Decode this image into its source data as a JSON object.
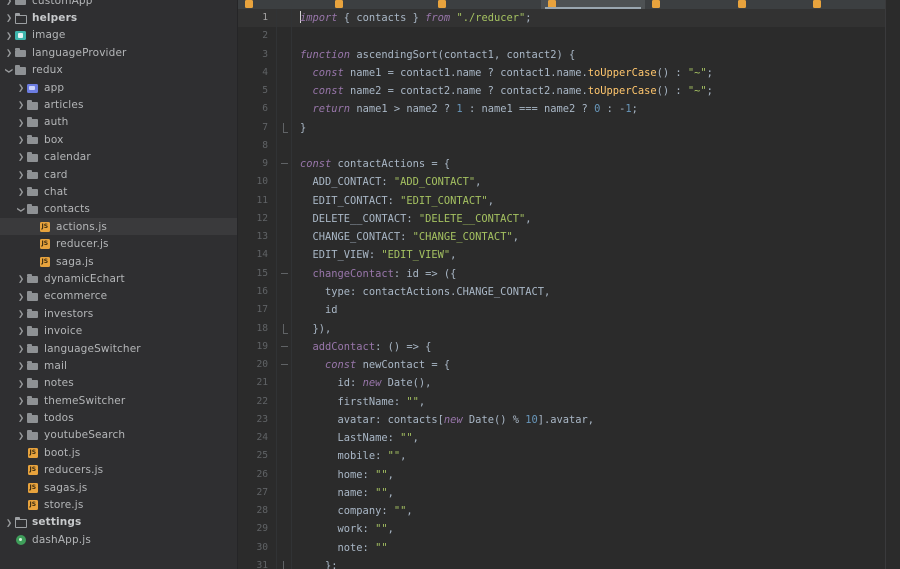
{
  "app": {
    "theme_bg": "#2b2b2b",
    "sidebar_bg": "#2f2f31",
    "accent": "#e8a33d"
  },
  "sidebar": {
    "name": "project-tree",
    "items": [
      {
        "label": "customApp",
        "indent": 1,
        "icon": "folder",
        "arrow": "closed",
        "bold": false,
        "selected": false
      },
      {
        "label": "helpers",
        "indent": 1,
        "icon": "folder-open",
        "arrow": "closed",
        "bold": true,
        "selected": false
      },
      {
        "label": "image",
        "indent": 1,
        "icon": "img-folder",
        "arrow": "closed",
        "bold": false,
        "selected": false
      },
      {
        "label": "languageProvider",
        "indent": 1,
        "icon": "folder",
        "arrow": "closed",
        "bold": false,
        "selected": false
      },
      {
        "label": "redux",
        "indent": 1,
        "icon": "folder",
        "arrow": "open",
        "bold": false,
        "selected": false
      },
      {
        "label": "app",
        "indent": 2,
        "icon": "blue-folder",
        "arrow": "closed",
        "bold": false,
        "selected": false
      },
      {
        "label": "articles",
        "indent": 2,
        "icon": "folder",
        "arrow": "closed",
        "bold": false,
        "selected": false
      },
      {
        "label": "auth",
        "indent": 2,
        "icon": "folder",
        "arrow": "closed",
        "bold": false,
        "selected": false
      },
      {
        "label": "box",
        "indent": 2,
        "icon": "folder",
        "arrow": "closed",
        "bold": false,
        "selected": false
      },
      {
        "label": "calendar",
        "indent": 2,
        "icon": "folder",
        "arrow": "closed",
        "bold": false,
        "selected": false
      },
      {
        "label": "card",
        "indent": 2,
        "icon": "folder",
        "arrow": "closed",
        "bold": false,
        "selected": false
      },
      {
        "label": "chat",
        "indent": 2,
        "icon": "folder",
        "arrow": "closed",
        "bold": false,
        "selected": false
      },
      {
        "label": "contacts",
        "indent": 2,
        "icon": "folder",
        "arrow": "open",
        "bold": false,
        "selected": false
      },
      {
        "label": "actions.js",
        "indent": 3,
        "icon": "js",
        "arrow": "none",
        "bold": false,
        "selected": true
      },
      {
        "label": "reducer.js",
        "indent": 3,
        "icon": "js",
        "arrow": "none",
        "bold": false,
        "selected": false
      },
      {
        "label": "saga.js",
        "indent": 3,
        "icon": "js",
        "arrow": "none",
        "bold": false,
        "selected": false
      },
      {
        "label": "dynamicEchart",
        "indent": 2,
        "icon": "folder",
        "arrow": "closed",
        "bold": false,
        "selected": false
      },
      {
        "label": "ecommerce",
        "indent": 2,
        "icon": "folder",
        "arrow": "closed",
        "bold": false,
        "selected": false
      },
      {
        "label": "investors",
        "indent": 2,
        "icon": "folder",
        "arrow": "closed",
        "bold": false,
        "selected": false
      },
      {
        "label": "invoice",
        "indent": 2,
        "icon": "folder",
        "arrow": "closed",
        "bold": false,
        "selected": false
      },
      {
        "label": "languageSwitcher",
        "indent": 2,
        "icon": "folder",
        "arrow": "closed",
        "bold": false,
        "selected": false
      },
      {
        "label": "mail",
        "indent": 2,
        "icon": "folder",
        "arrow": "closed",
        "bold": false,
        "selected": false
      },
      {
        "label": "notes",
        "indent": 2,
        "icon": "folder",
        "arrow": "closed",
        "bold": false,
        "selected": false
      },
      {
        "label": "themeSwitcher",
        "indent": 2,
        "icon": "folder",
        "arrow": "closed",
        "bold": false,
        "selected": false
      },
      {
        "label": "todos",
        "indent": 2,
        "icon": "folder",
        "arrow": "closed",
        "bold": false,
        "selected": false
      },
      {
        "label": "youtubeSearch",
        "indent": 2,
        "icon": "folder",
        "arrow": "closed",
        "bold": false,
        "selected": false
      },
      {
        "label": "boot.js",
        "indent": 2,
        "icon": "js",
        "arrow": "none",
        "bold": false,
        "selected": false
      },
      {
        "label": "reducers.js",
        "indent": 2,
        "icon": "js",
        "arrow": "none",
        "bold": false,
        "selected": false
      },
      {
        "label": "sagas.js",
        "indent": 2,
        "icon": "js",
        "arrow": "none",
        "bold": false,
        "selected": false
      },
      {
        "label": "store.js",
        "indent": 2,
        "icon": "js",
        "arrow": "none",
        "bold": false,
        "selected": false
      },
      {
        "label": "settings",
        "indent": 1,
        "icon": "folder-open",
        "arrow": "closed",
        "bold": true,
        "selected": false
      },
      {
        "label": "dashApp.js",
        "indent": 1,
        "icon": "green-circle",
        "arrow": "none",
        "bold": false,
        "selected": false
      }
    ]
  },
  "tabs": {
    "name": "editor-tabs",
    "items": [
      {
        "label": "",
        "icon": "js-file-icon",
        "active": false
      },
      {
        "label": "",
        "icon": "js-file-icon",
        "active": false
      },
      {
        "label": "",
        "icon": "js-file-icon",
        "active": false
      },
      {
        "label": "",
        "icon": "js-file-icon",
        "active": true
      },
      {
        "label": "",
        "icon": "js-file-icon",
        "active": false
      },
      {
        "label": "",
        "icon": "js-file-icon",
        "active": false
      },
      {
        "label": "",
        "icon": "js-file-icon",
        "active": false
      }
    ]
  },
  "editor": {
    "file": "actions.js",
    "caret_line": 1,
    "caret_column": 1,
    "first_line": 1,
    "last_line": 31,
    "lines": [
      {
        "n": "1",
        "fold": "",
        "hl": true,
        "tokens": [
          {
            "t": "caret",
            "v": ""
          },
          {
            "c": "kwi",
            "v": "import"
          },
          {
            "c": "plain",
            "v": " { "
          },
          {
            "c": "plain",
            "v": "contacts"
          },
          {
            "c": "plain",
            "v": " } "
          },
          {
            "c": "kwi",
            "v": "from"
          },
          {
            "c": "plain",
            "v": " "
          },
          {
            "c": "str",
            "v": "\"./reducer\""
          },
          {
            "c": "plain",
            "v": ";"
          }
        ]
      },
      {
        "n": "2",
        "fold": "",
        "hl": false,
        "tokens": []
      },
      {
        "n": "3",
        "fold": "",
        "hl": false,
        "tokens": [
          {
            "c": "kwi",
            "v": "function"
          },
          {
            "c": "plain",
            "v": " "
          },
          {
            "c": "plain",
            "v": "ascendingSort"
          },
          {
            "c": "plain",
            "v": "(contact1, contact2) {"
          }
        ]
      },
      {
        "n": "4",
        "fold": "",
        "hl": false,
        "tokens": [
          {
            "c": "plain",
            "v": "  "
          },
          {
            "c": "kwi",
            "v": "const"
          },
          {
            "c": "plain",
            "v": " name1 = contact1.name ? contact1.name."
          },
          {
            "c": "fn",
            "v": "toUpperCase"
          },
          {
            "c": "plain",
            "v": "() : "
          },
          {
            "c": "str",
            "v": "\"~\""
          },
          {
            "c": "plain",
            "v": ";"
          }
        ]
      },
      {
        "n": "5",
        "fold": "",
        "hl": false,
        "tokens": [
          {
            "c": "plain",
            "v": "  "
          },
          {
            "c": "kwi",
            "v": "const"
          },
          {
            "c": "plain",
            "v": " name2 = contact2.name ? contact2.name."
          },
          {
            "c": "fn",
            "v": "toUpperCase"
          },
          {
            "c": "plain",
            "v": "() : "
          },
          {
            "c": "str",
            "v": "\"~\""
          },
          {
            "c": "plain",
            "v": ";"
          }
        ]
      },
      {
        "n": "6",
        "fold": "",
        "hl": false,
        "tokens": [
          {
            "c": "plain",
            "v": "  "
          },
          {
            "c": "kwi",
            "v": "return"
          },
          {
            "c": "plain",
            "v": " name1 > name2 ? "
          },
          {
            "c": "num",
            "v": "1"
          },
          {
            "c": "plain",
            "v": " : name1 === name2 ? "
          },
          {
            "c": "num",
            "v": "0"
          },
          {
            "c": "plain",
            "v": " : -"
          },
          {
            "c": "num",
            "v": "1"
          },
          {
            "c": "plain",
            "v": ";"
          }
        ]
      },
      {
        "n": "7",
        "fold": "end",
        "hl": false,
        "tokens": [
          {
            "c": "plain",
            "v": "}"
          }
        ]
      },
      {
        "n": "8",
        "fold": "",
        "hl": false,
        "tokens": []
      },
      {
        "n": "9",
        "fold": "minus",
        "hl": false,
        "tokens": [
          {
            "c": "kwi",
            "v": "const"
          },
          {
            "c": "plain",
            "v": " contactActions = {"
          }
        ]
      },
      {
        "n": "10",
        "fold": "",
        "hl": false,
        "tokens": [
          {
            "c": "plain",
            "v": "  ADD_CONTACT: "
          },
          {
            "c": "str",
            "v": "\"ADD_CONTACT\""
          },
          {
            "c": "plain",
            "v": ","
          }
        ]
      },
      {
        "n": "11",
        "fold": "",
        "hl": false,
        "tokens": [
          {
            "c": "plain",
            "v": "  EDIT_CONTACT: "
          },
          {
            "c": "str",
            "v": "\"EDIT_CONTACT\""
          },
          {
            "c": "plain",
            "v": ","
          }
        ]
      },
      {
        "n": "12",
        "fold": "",
        "hl": false,
        "tokens": [
          {
            "c": "plain",
            "v": "  DELETE__CONTACT: "
          },
          {
            "c": "str",
            "v": "\"DELETE__CONTACT\""
          },
          {
            "c": "plain",
            "v": ","
          }
        ]
      },
      {
        "n": "13",
        "fold": "",
        "hl": false,
        "tokens": [
          {
            "c": "plain",
            "v": "  CHANGE_CONTACT: "
          },
          {
            "c": "str",
            "v": "\"CHANGE_CONTACT\""
          },
          {
            "c": "plain",
            "v": ","
          }
        ]
      },
      {
        "n": "14",
        "fold": "",
        "hl": false,
        "tokens": [
          {
            "c": "plain",
            "v": "  EDIT_VIEW: "
          },
          {
            "c": "str",
            "v": "\"EDIT_VIEW\""
          },
          {
            "c": "plain",
            "v": ","
          }
        ]
      },
      {
        "n": "15",
        "fold": "minus",
        "hl": false,
        "tokens": [
          {
            "c": "plain",
            "v": "  "
          },
          {
            "c": "prop",
            "v": "changeContact"
          },
          {
            "c": "plain",
            "v": ": id => ({"
          }
        ]
      },
      {
        "n": "16",
        "fold": "",
        "hl": false,
        "tokens": [
          {
            "c": "plain",
            "v": "    type: contactActions.CHANGE_CONTACT,"
          }
        ]
      },
      {
        "n": "17",
        "fold": "",
        "hl": false,
        "tokens": [
          {
            "c": "plain",
            "v": "    id"
          }
        ]
      },
      {
        "n": "18",
        "fold": "end",
        "hl": false,
        "tokens": [
          {
            "c": "plain",
            "v": "  }),"
          }
        ]
      },
      {
        "n": "19",
        "fold": "minus",
        "hl": false,
        "tokens": [
          {
            "c": "plain",
            "v": "  "
          },
          {
            "c": "prop",
            "v": "addContact"
          },
          {
            "c": "plain",
            "v": ": () => {"
          }
        ]
      },
      {
        "n": "20",
        "fold": "minus",
        "hl": false,
        "tokens": [
          {
            "c": "plain",
            "v": "    "
          },
          {
            "c": "kwi",
            "v": "const"
          },
          {
            "c": "plain",
            "v": " newContact = {"
          }
        ]
      },
      {
        "n": "21",
        "fold": "",
        "hl": false,
        "tokens": [
          {
            "c": "plain",
            "v": "      id: "
          },
          {
            "c": "kwi",
            "v": "new"
          },
          {
            "c": "plain",
            "v": " Date(),"
          }
        ]
      },
      {
        "n": "22",
        "fold": "",
        "hl": false,
        "tokens": [
          {
            "c": "plain",
            "v": "      firstName: "
          },
          {
            "c": "str",
            "v": "\"\""
          },
          {
            "c": "plain",
            "v": ","
          }
        ]
      },
      {
        "n": "23",
        "fold": "",
        "hl": false,
        "tokens": [
          {
            "c": "plain",
            "v": "      avatar: contacts["
          },
          {
            "c": "kwi",
            "v": "new"
          },
          {
            "c": "plain",
            "v": " Date() % "
          },
          {
            "c": "num",
            "v": "10"
          },
          {
            "c": "plain",
            "v": "].avatar,"
          }
        ]
      },
      {
        "n": "24",
        "fold": "",
        "hl": false,
        "tokens": [
          {
            "c": "plain",
            "v": "      LastName: "
          },
          {
            "c": "str",
            "v": "\"\""
          },
          {
            "c": "plain",
            "v": ","
          }
        ]
      },
      {
        "n": "25",
        "fold": "",
        "hl": false,
        "tokens": [
          {
            "c": "plain",
            "v": "      mobile: "
          },
          {
            "c": "str",
            "v": "\"\""
          },
          {
            "c": "plain",
            "v": ","
          }
        ]
      },
      {
        "n": "26",
        "fold": "",
        "hl": false,
        "tokens": [
          {
            "c": "plain",
            "v": "      home: "
          },
          {
            "c": "str",
            "v": "\"\""
          },
          {
            "c": "plain",
            "v": ","
          }
        ]
      },
      {
        "n": "27",
        "fold": "",
        "hl": false,
        "tokens": [
          {
            "c": "plain",
            "v": "      name: "
          },
          {
            "c": "str",
            "v": "\"\""
          },
          {
            "c": "plain",
            "v": ","
          }
        ]
      },
      {
        "n": "28",
        "fold": "",
        "hl": false,
        "tokens": [
          {
            "c": "plain",
            "v": "      company: "
          },
          {
            "c": "str",
            "v": "\"\""
          },
          {
            "c": "plain",
            "v": ","
          }
        ]
      },
      {
        "n": "29",
        "fold": "",
        "hl": false,
        "tokens": [
          {
            "c": "plain",
            "v": "      work: "
          },
          {
            "c": "str",
            "v": "\"\""
          },
          {
            "c": "plain",
            "v": ","
          }
        ]
      },
      {
        "n": "30",
        "fold": "",
        "hl": false,
        "tokens": [
          {
            "c": "plain",
            "v": "      note: "
          },
          {
            "c": "str",
            "v": "\"\""
          }
        ]
      },
      {
        "n": "31",
        "fold": "end",
        "hl": false,
        "tokens": [
          {
            "c": "plain",
            "v": "    };"
          }
        ]
      }
    ]
  }
}
